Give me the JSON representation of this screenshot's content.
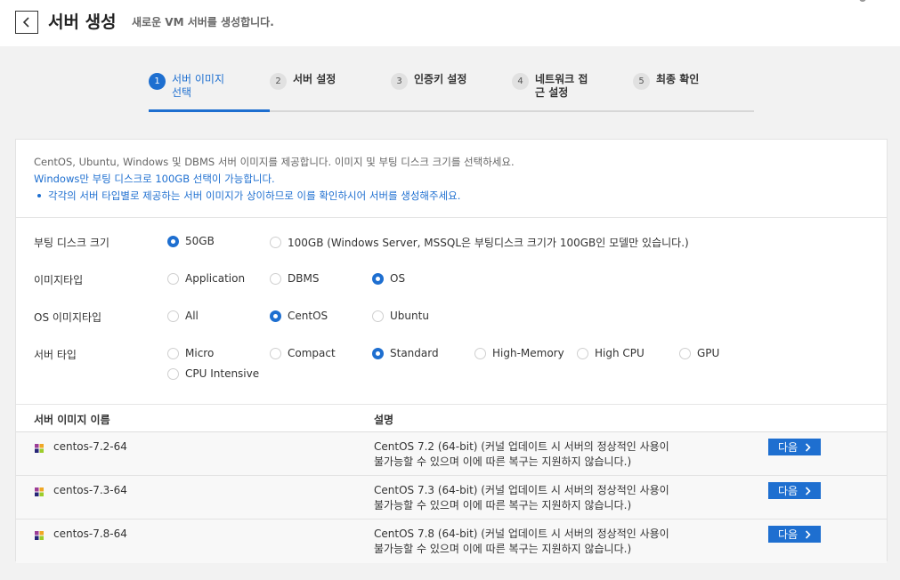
{
  "header": {
    "title": "서버 생성",
    "subtitle": "새로운 VM 서버를 생성합니다."
  },
  "steps": [
    {
      "num": "1",
      "label": "서버 이미지 선택",
      "active": true
    },
    {
      "num": "2",
      "label": "서버 설정",
      "active": false
    },
    {
      "num": "3",
      "label": "인증키 설정",
      "active": false
    },
    {
      "num": "4",
      "label": "네트워크 접근 설정",
      "active": false
    },
    {
      "num": "5",
      "label": "최종 확인",
      "active": false
    }
  ],
  "notice": {
    "line1": "CentOS, Ubuntu, Windows 및 DBMS 서버 이미지를 제공합니다. 이미지 및 부팅 디스크 크기를 선택하세요.",
    "line2": "Windows만 부팅 디스크로 100GB 선택이 가능합니다.",
    "line3": "각각의 서버 타입별로 제공하는 서버 이미지가 상이하므로 이를 확인하시어 서버를 생성해주세요."
  },
  "form": {
    "boot_disk": {
      "label": "부팅 디스크 크기",
      "options": [
        "50GB",
        "100GB (Windows Server, MSSQL은 부팅디스크 크기가 100GB인 모델만 있습니다.)"
      ],
      "selected": "50GB"
    },
    "image_type": {
      "label": "이미지타입",
      "options": [
        "Application",
        "DBMS",
        "OS"
      ],
      "selected": "OS"
    },
    "os_image_type": {
      "label": "OS 이미지타입",
      "options": [
        "All",
        "CentOS",
        "Ubuntu"
      ],
      "selected": "CentOS"
    },
    "server_type": {
      "label": "서버 타입",
      "options": [
        "Micro",
        "Compact",
        "Standard",
        "High-Memory",
        "High CPU",
        "GPU",
        "CPU Intensive"
      ],
      "selected": "Standard"
    }
  },
  "table": {
    "col_name": "서버 이미지 이름",
    "col_desc": "설명",
    "next_label": "다음",
    "rows": [
      {
        "name": "centos-7.2-64",
        "desc1": "CentOS 7.2 (64-bit) (커널 업데이트 시 서버의 정상적인 사용이",
        "desc2": "불가능할 수 있으며 이에 따른 복구는 지원하지 않습니다.)"
      },
      {
        "name": "centos-7.3-64",
        "desc1": "CentOS 7.3 (64-bit) (커널 업데이트 시 서버의 정상적인 사용이",
        "desc2": "불가능할 수 있으며 이에 따른 복구는 지원하지 않습니다.)"
      },
      {
        "name": "centos-7.8-64",
        "desc1": "CentOS 7.8 (64-bit) (커널 업데이트 시 서버의 정상적인 사용이",
        "desc2": "불가능할 수 있으며 이에 따른 복구는 지원하지 않습니다.)"
      }
    ]
  },
  "colors": {
    "accent": "#1e6fd0"
  },
  "icons": {
    "back": "chevron-left-icon",
    "next": "chevron-right-icon",
    "image": "centos-logo-icon"
  }
}
